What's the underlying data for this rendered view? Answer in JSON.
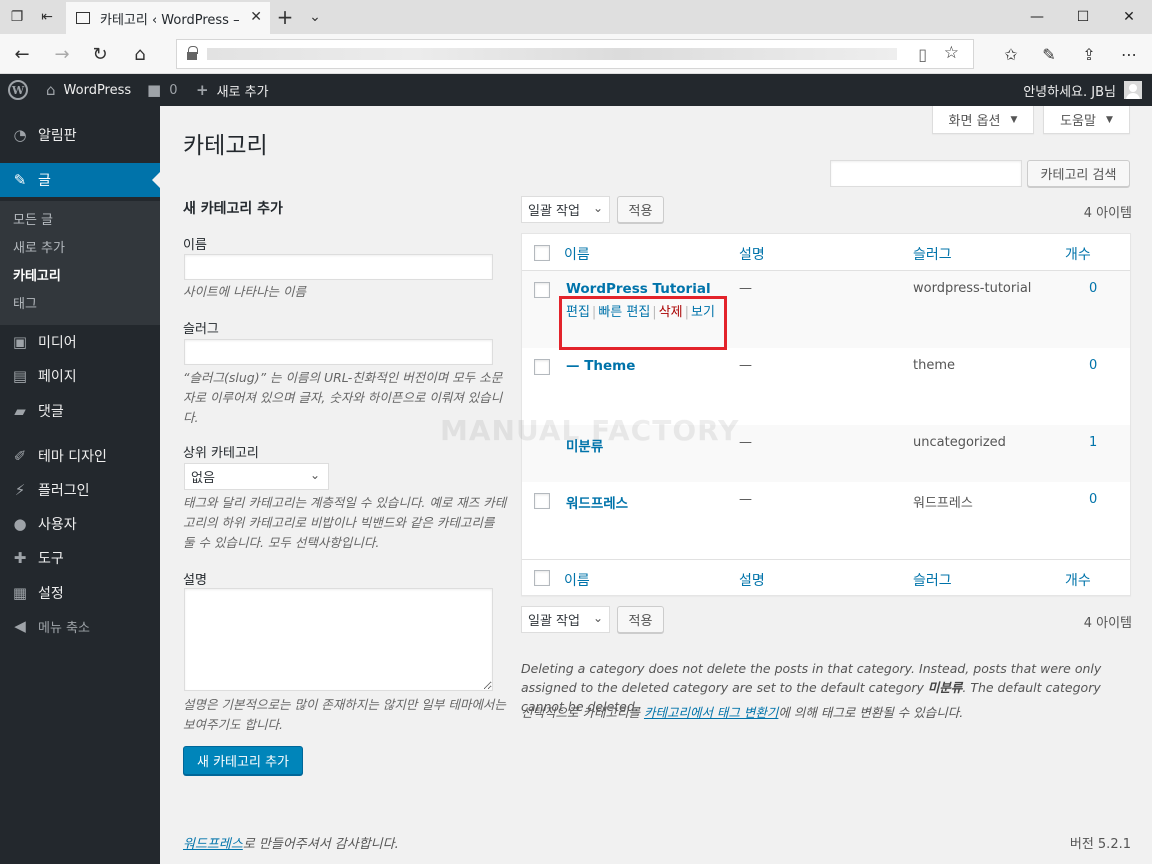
{
  "browser": {
    "tab_title": "카테고리 ‹ WordPress –",
    "url_blurred": true
  },
  "adminbar": {
    "site_name": "WordPress",
    "comments_count": "0",
    "new_label": "새로 추가",
    "greeting": "안녕하세요. JB님"
  },
  "sidebar": {
    "items": [
      {
        "label": "알림판",
        "icon": "dashboard-icon"
      },
      {
        "label": "글",
        "icon": "pushpin-icon"
      },
      {
        "label": "미디어",
        "icon": "media-icon"
      },
      {
        "label": "페이지",
        "icon": "page-icon"
      },
      {
        "label": "댓글",
        "icon": "comment-icon"
      },
      {
        "label": "테마 디자인",
        "icon": "brush-icon"
      },
      {
        "label": "플러그인",
        "icon": "plugin-icon"
      },
      {
        "label": "사용자",
        "icon": "user-icon"
      },
      {
        "label": "도구",
        "icon": "wrench-icon"
      },
      {
        "label": "설정",
        "icon": "settings-icon"
      }
    ],
    "submenu": [
      "모든 글",
      "새로 추가",
      "카테고리",
      "태그"
    ],
    "collapse_label": "메뉴 축소"
  },
  "header": {
    "screen_options": "화면 옵션",
    "help": "도움말",
    "page_title": "카테고리",
    "search_button": "카테고리 검색",
    "search_placeholder": ""
  },
  "form": {
    "heading": "새 카테고리 추가",
    "name_label": "이름",
    "name_help": "사이트에 나타나는 이름",
    "slug_label": "슬러그",
    "slug_help": "“슬러그(slug)” 는 이름의 URL-친화적인 버전이며 모두 소문자로 이루어져 있으며 글자, 숫자와 하이픈으로 이뤄져 있습니다.",
    "parent_label": "상위 카테고리",
    "parent_value": "없음",
    "parent_help": "태그와 달리 카테고리는 계층적일 수 있습니다. 예로 재즈 카테고리의 하위 카테고리로 비밥이나 빅밴드와 같은 카테고리를 둘 수 있습니다. 모두 선택사항입니다.",
    "desc_label": "설명",
    "desc_help": "설명은 기본적으로는 많이 존재하지는 않지만 일부 테마에서는 보여주기도 합니다.",
    "submit": "새 카테고리 추가"
  },
  "list": {
    "bulk_label": "일괄 작업",
    "apply_label": "적용",
    "item_count": "4 아이템",
    "columns": {
      "name": "이름",
      "description": "설명",
      "slug": "슬러그",
      "count": "개수"
    },
    "rows": [
      {
        "name": "WordPress Tutorial",
        "description": "—",
        "slug": "wordpress-tutorial",
        "count": "0"
      },
      {
        "name": "— Theme",
        "description": "—",
        "slug": "theme",
        "count": "0"
      },
      {
        "name": "미분류",
        "description": "—",
        "slug": "uncategorized",
        "count": "1"
      },
      {
        "name": "워드프레스",
        "description": "—",
        "slug": "워드프레스",
        "count": "0"
      }
    ],
    "row_actions": {
      "edit": "편집",
      "quick_edit": "빠른 편집",
      "delete": "삭제",
      "view": "보기"
    }
  },
  "notes": {
    "delete_note_a": "Deleting a category does not delete the posts in that category. Instead, posts that were only assigned to the deleted category are set to the default category ",
    "delete_note_default": "미분류",
    "delete_note_b": ". The default category cannot be deleted.",
    "convert_a": "선택적으로 카테고리를 ",
    "convert_link": "카테고리에서 태그 변환기",
    "convert_b": "에 의해 태그로 변환될 수 있습니다."
  },
  "watermark": "MANUAL FACTORY",
  "footer": {
    "link": "워드프레스",
    "text": "로 만들어주셔서 감사합니다.",
    "version": "버전 5.2.1"
  },
  "colors": {
    "wp_blue": "#0073aa",
    "admin_dark": "#23282d",
    "delete_red": "#a00",
    "highlight_red": "#e3232b"
  }
}
